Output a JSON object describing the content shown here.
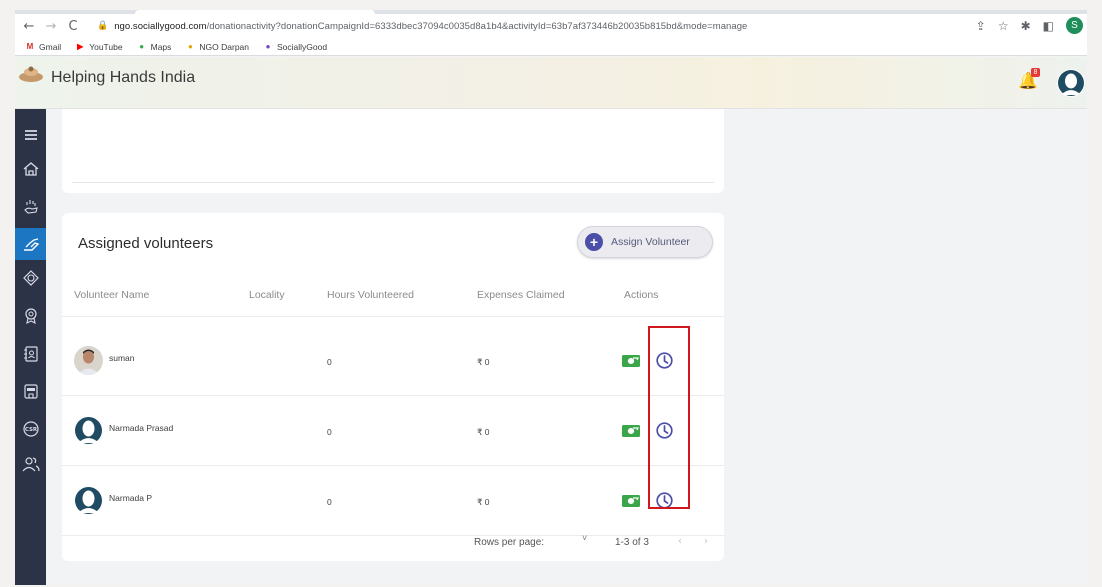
{
  "browser": {
    "url_host": "ngo.sociallygood.com",
    "url_path": "/donationactivity?donationCampaignId=6333dbec37094c0035d8a1b4&activityId=63b7af373446b20035b815bd&mode=manage",
    "profile_initial": "S",
    "bookmarks": [
      {
        "label": "Gmail",
        "icon": "gmail-icon",
        "color": "#d93025",
        "glyph": "M"
      },
      {
        "label": "YouTube",
        "icon": "youtube-icon",
        "color": "#ff0000",
        "glyph": "▶"
      },
      {
        "label": "Maps",
        "icon": "maps-icon",
        "color": "#34a853",
        "glyph": "●"
      },
      {
        "label": "NGO Darpan",
        "icon": "ngo-darpan-icon",
        "color": "#e0a800",
        "glyph": "●"
      },
      {
        "label": "SociallyGood",
        "icon": "sociallygood-icon",
        "color": "#7b3fbf",
        "glyph": "●"
      }
    ]
  },
  "header": {
    "brand": "Helping Hands India",
    "notification_count": "8"
  },
  "sidebar": {
    "items": [
      {
        "icon": "menu-icon"
      },
      {
        "icon": "home-icon"
      },
      {
        "icon": "donation-hand-icon"
      },
      {
        "icon": "volunteer-activity-icon",
        "active": true
      },
      {
        "icon": "badge-icon"
      },
      {
        "icon": "award-icon"
      },
      {
        "icon": "contacts-icon"
      },
      {
        "icon": "ngo-icon"
      },
      {
        "icon": "csr-icon"
      },
      {
        "icon": "users-icon"
      }
    ]
  },
  "volunteers": {
    "title": "Assigned volunteers",
    "assign_button": "Assign Volunteer",
    "columns": [
      "Volunteer Name",
      "Locality",
      "Hours Volunteered",
      "Expenses Claimed",
      "Actions"
    ],
    "rows": [
      {
        "name": "suman",
        "locality": "",
        "hours": "0",
        "expenses": "₹ 0",
        "avatar": "photo"
      },
      {
        "name": "Narmada Prasad",
        "locality": "",
        "hours": "0",
        "expenses": "₹ 0",
        "avatar": "placeholder"
      },
      {
        "name": "Narmada P",
        "locality": "",
        "hours": "0",
        "expenses": "₹ 0",
        "avatar": "placeholder"
      }
    ],
    "pagination": {
      "rows_per_page_label": "Rows per page:",
      "rows_per_page_caret": "˅",
      "range": "1-3 of 3",
      "prev": "‹",
      "next": "›"
    }
  },
  "colors": {
    "sidebar_bg": "#2c3347",
    "sidebar_active": "#1d76c2",
    "accent": "#4b4fa8",
    "money_green": "#3aa64a",
    "highlight_red": "#d2161e"
  }
}
